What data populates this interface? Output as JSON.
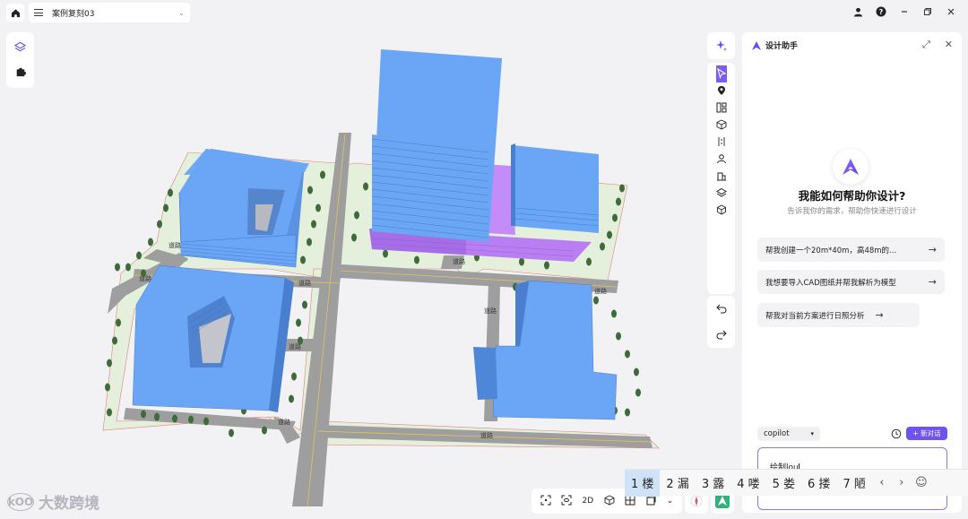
{
  "topbar": {
    "project_name": "案例复刻03",
    "icons": [
      "home-icon",
      "menu-icon",
      "chevron-down-icon",
      "user-icon",
      "help-icon",
      "minimize-icon",
      "restore-icon",
      "close-icon"
    ]
  },
  "viewport": {
    "road_label": "道路"
  },
  "assistant": {
    "header_title": "设计助手",
    "title": "我能如何帮助你设计?",
    "subtitle": "告诉我你的需求，帮助你快速进行设计",
    "suggestions": [
      "帮我创建一个20m*40m，高48m的...",
      "我想要导入CAD图纸并帮我解析为模型",
      "帮我对当前方案进行日照分析"
    ],
    "model_select": "copilot",
    "new_chat_label": "+ 新对话",
    "input_value": "绘制lou"
  },
  "ime": {
    "candidates": [
      "1 楼",
      "2 漏",
      "3 露",
      "4 喽",
      "5 娄",
      "6 搂",
      "7 陋"
    ],
    "selected_index": 0
  },
  "bottom_bar": {
    "mode_2d": "2D"
  },
  "watermark": {
    "text": "大数跨境",
    "logo_text": "kOO"
  },
  "colors": {
    "accent": "#7b5cf5",
    "building_blue": "#6aa6f5",
    "podium_purple": "#c084f5",
    "road": "#9a9a9a",
    "green": "#e3efdc"
  }
}
